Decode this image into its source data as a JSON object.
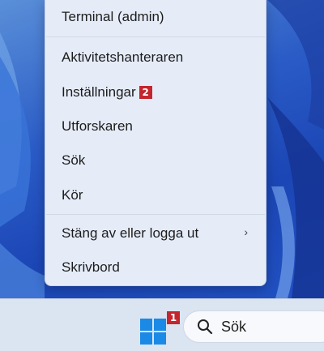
{
  "context_menu": {
    "items": [
      {
        "label": "Terminal (admin)"
      },
      {
        "label": "Aktivitetshanteraren"
      },
      {
        "label": "Inställningar",
        "badge": "2"
      },
      {
        "label": "Utforskaren"
      },
      {
        "label": "Sök"
      },
      {
        "label": "Kör"
      },
      {
        "label": "Stäng av eller logga ut"
      },
      {
        "label": "Skrivbord"
      }
    ]
  },
  "taskbar": {
    "start_badge": "1",
    "search_label": "Sök"
  },
  "colors": {
    "badge": "#c4262e",
    "menu_bg": "#e5ecf8",
    "windows_logo": "#1a8ae6"
  }
}
